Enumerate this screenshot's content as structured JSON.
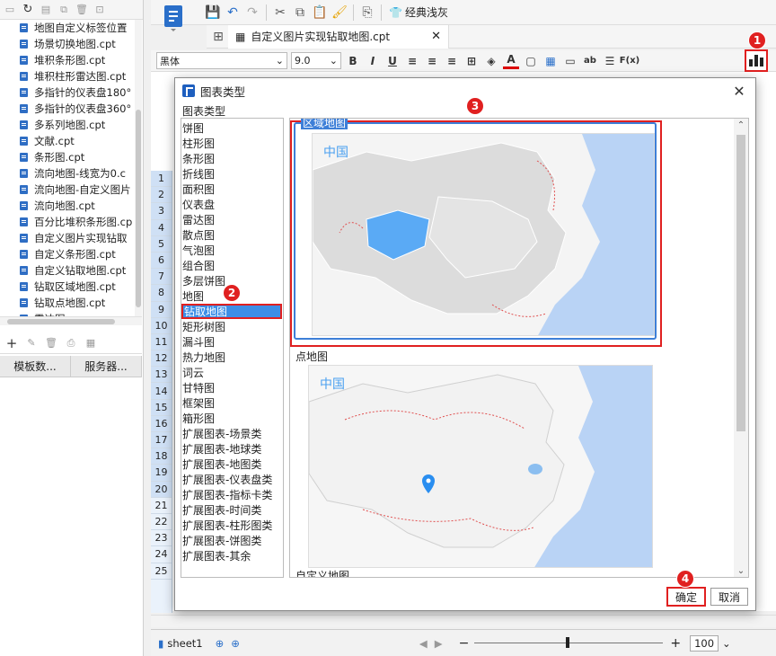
{
  "file_list": [
    "地图自定义标签位置",
    "场景切换地图.cpt",
    "堆积条形图.cpt",
    "堆积柱形雷达图.cpt",
    "多指针的仪表盘180°",
    "多指针的仪表盘360°",
    "多系列地图.cpt",
    "文献.cpt",
    "条形图.cpt",
    "流向地图-线宽为0.c",
    "流向地图-自定义图片",
    "流向地图.cpt",
    "百分比堆积条形图.cp",
    "自定义图片实现钻取",
    "自定义条形图.cpt",
    "自定义钻取地图.cpt",
    "钻取区域地图.cpt",
    "钻取点地图.cpt",
    "雷达图"
  ],
  "left_tabs": [
    "模板数...",
    "服务器..."
  ],
  "toolbar": {
    "classic_label": "经典浅灰"
  },
  "doc_tab": {
    "label": "自定义图片实现钻取地图.cpt"
  },
  "format": {
    "font_name": "黑体",
    "font_size": "9.0"
  },
  "sheet": {
    "rows": [
      "1",
      "2",
      "3",
      "4",
      "5",
      "6",
      "7",
      "8",
      "9",
      "10",
      "11",
      "12",
      "13",
      "14",
      "15",
      "16",
      "17",
      "18",
      "19",
      "20",
      "21",
      "22",
      "23",
      "24",
      "25"
    ],
    "sheet_tab": "sheet1",
    "zoom": "100"
  },
  "dialog": {
    "title": "图表类型",
    "group_label": "图表类型",
    "chart_types": [
      "饼图",
      "柱形图",
      "条形图",
      "折线图",
      "面积图",
      "仪表盘",
      "雷达图",
      "散点图",
      "气泡图",
      "组合图",
      "多层饼图",
      "地图",
      "钻取地图",
      "矩形树图",
      "漏斗图",
      "热力地图",
      "词云",
      "甘特图",
      "框架图",
      "箱形图",
      "扩展图表-场景类",
      "扩展图表-地球类",
      "扩展图表-地图类",
      "扩展图表-仪表盘类",
      "扩展图表-指标卡类",
      "扩展图表-时间类",
      "扩展图表-柱形图类",
      "扩展图表-饼图类",
      "扩展图表-其余"
    ],
    "selected_type": "钻取地图",
    "previews": [
      {
        "title": "区域地图",
        "map_label": "中国"
      },
      {
        "title": "点地图",
        "map_label": "中国"
      },
      {
        "title": "自定义地图"
      }
    ],
    "ok_label": "确定",
    "cancel_label": "取消"
  },
  "callouts": [
    "1",
    "2",
    "3",
    "4"
  ],
  "colors": {
    "highlight": "#e02020",
    "selection": "#3d8ee6",
    "province_fill": "#5aaaf5"
  }
}
